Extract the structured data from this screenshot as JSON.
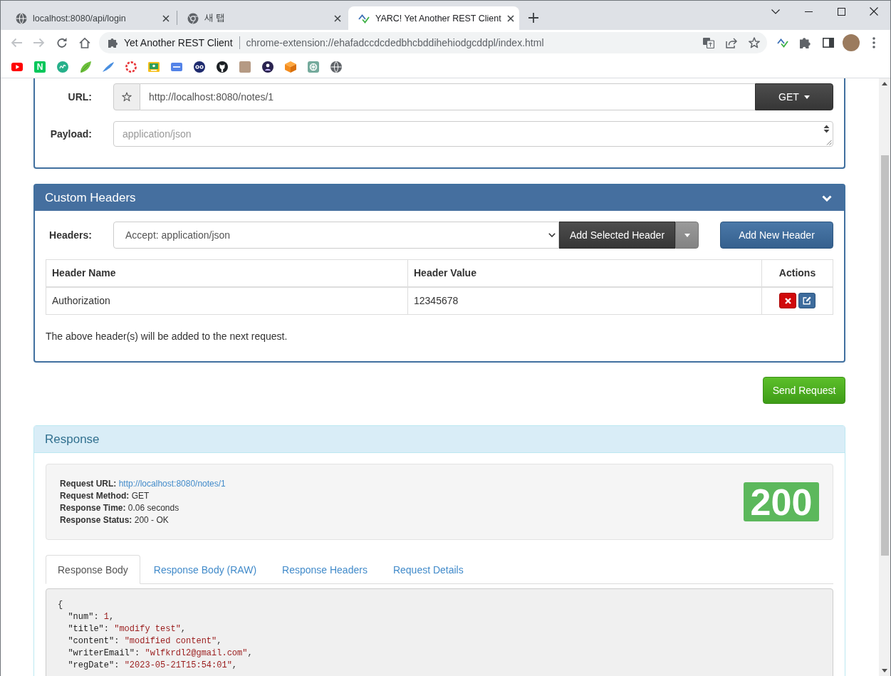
{
  "browser": {
    "tabs": [
      {
        "kind": "site",
        "title": "localhost:8080/api/login",
        "selected": false
      },
      {
        "kind": "newtab",
        "title": "새 탭",
        "selected": false
      },
      {
        "kind": "extension",
        "title": "YARC! Yet Another REST Client",
        "selected": true
      }
    ],
    "navigation": {
      "back": {
        "disabled": true
      },
      "forward": {
        "disabled": true
      }
    },
    "address_bar": {
      "site_name": "Yet Another REST Client",
      "url": "chrome-extension://ehafadccdcdedbhcbddihehiodgcddpl/index.html"
    },
    "bookmarks": [
      {
        "kind": "icon"
      },
      {
        "kind": "letter",
        "text": "N"
      },
      {
        "kind": "icon"
      },
      {
        "kind": "icon"
      },
      {
        "kind": "icon"
      },
      {
        "kind": "icon"
      },
      {
        "kind": "icon"
      },
      {
        "kind": "icon"
      },
      {
        "kind": "icon"
      },
      {
        "kind": "icon"
      },
      {
        "kind": "photo"
      },
      {
        "kind": "icon"
      },
      {
        "kind": "icon"
      },
      {
        "kind": "icon"
      },
      {
        "kind": "icon"
      }
    ]
  },
  "request": {
    "url": {
      "label": "URL:",
      "value": "http://localhost:8080/notes/1"
    },
    "method": "GET",
    "payload": {
      "label": "Payload:",
      "placeholder": "application/json"
    }
  },
  "custom_headers": {
    "title": "Custom Headers",
    "headers": {
      "label": "Headers:",
      "value": "Accept: application/json"
    },
    "buttons": {
      "add_selected": "Add Selected Header",
      "add_new": "Add New Header"
    },
    "table": {
      "columns": [
        "Header Name",
        "Header Value",
        "Actions"
      ],
      "rows": [
        {
          "cells": [
            "Authorization",
            "12345678"
          ]
        }
      ]
    },
    "note": "The above header(s) will be added to the next request."
  },
  "send_button": "Send Request",
  "response": {
    "title": "Response",
    "summary": [
      {
        "kind": "link",
        "label": "Request URL:",
        "value": "http://localhost:8080/notes/1"
      },
      {
        "kind": "text",
        "label": "Request Method:",
        "value": "GET"
      },
      {
        "kind": "text",
        "label": "Response Time:",
        "value": "0.06 seconds"
      },
      {
        "kind": "text",
        "label": "Response Status:",
        "value": "200 - OK"
      }
    ],
    "status_code": "200",
    "tabs": [
      {
        "label": "Response Body",
        "selected": true
      },
      {
        "label": "Response Body (RAW)",
        "selected": false
      },
      {
        "label": "Response Headers",
        "selected": false
      },
      {
        "label": "Request Details",
        "selected": false
      }
    ],
    "body": {
      "lines": [
        [
          {
            "kind": "punct",
            "text": "{"
          }
        ],
        [
          {
            "kind": "key",
            "text": "  \"num\""
          },
          {
            "kind": "punct",
            "text": ": "
          },
          {
            "kind": "number",
            "text": "1"
          },
          {
            "kind": "punct",
            "text": ","
          }
        ],
        [
          {
            "kind": "key",
            "text": "  \"title\""
          },
          {
            "kind": "punct",
            "text": ": "
          },
          {
            "kind": "string",
            "text": "\"modify test\""
          },
          {
            "kind": "punct",
            "text": ","
          }
        ],
        [
          {
            "kind": "key",
            "text": "  \"content\""
          },
          {
            "kind": "punct",
            "text": ": "
          },
          {
            "kind": "string",
            "text": "\"modified content\""
          },
          {
            "kind": "punct",
            "text": ","
          }
        ],
        [
          {
            "kind": "key",
            "text": "  \"writerEmail\""
          },
          {
            "kind": "punct",
            "text": ": "
          },
          {
            "kind": "string",
            "text": "\"wlfkrdl2@gmail.com\""
          },
          {
            "kind": "punct",
            "text": ","
          }
        ],
        [
          {
            "kind": "key",
            "text": "  \"regDate\""
          },
          {
            "kind": "punct",
            "text": ": "
          },
          {
            "kind": "string",
            "text": "\"2023-05-21T15:54:01\""
          },
          {
            "kind": "punct",
            "text": ","
          }
        ]
      ]
    }
  }
}
